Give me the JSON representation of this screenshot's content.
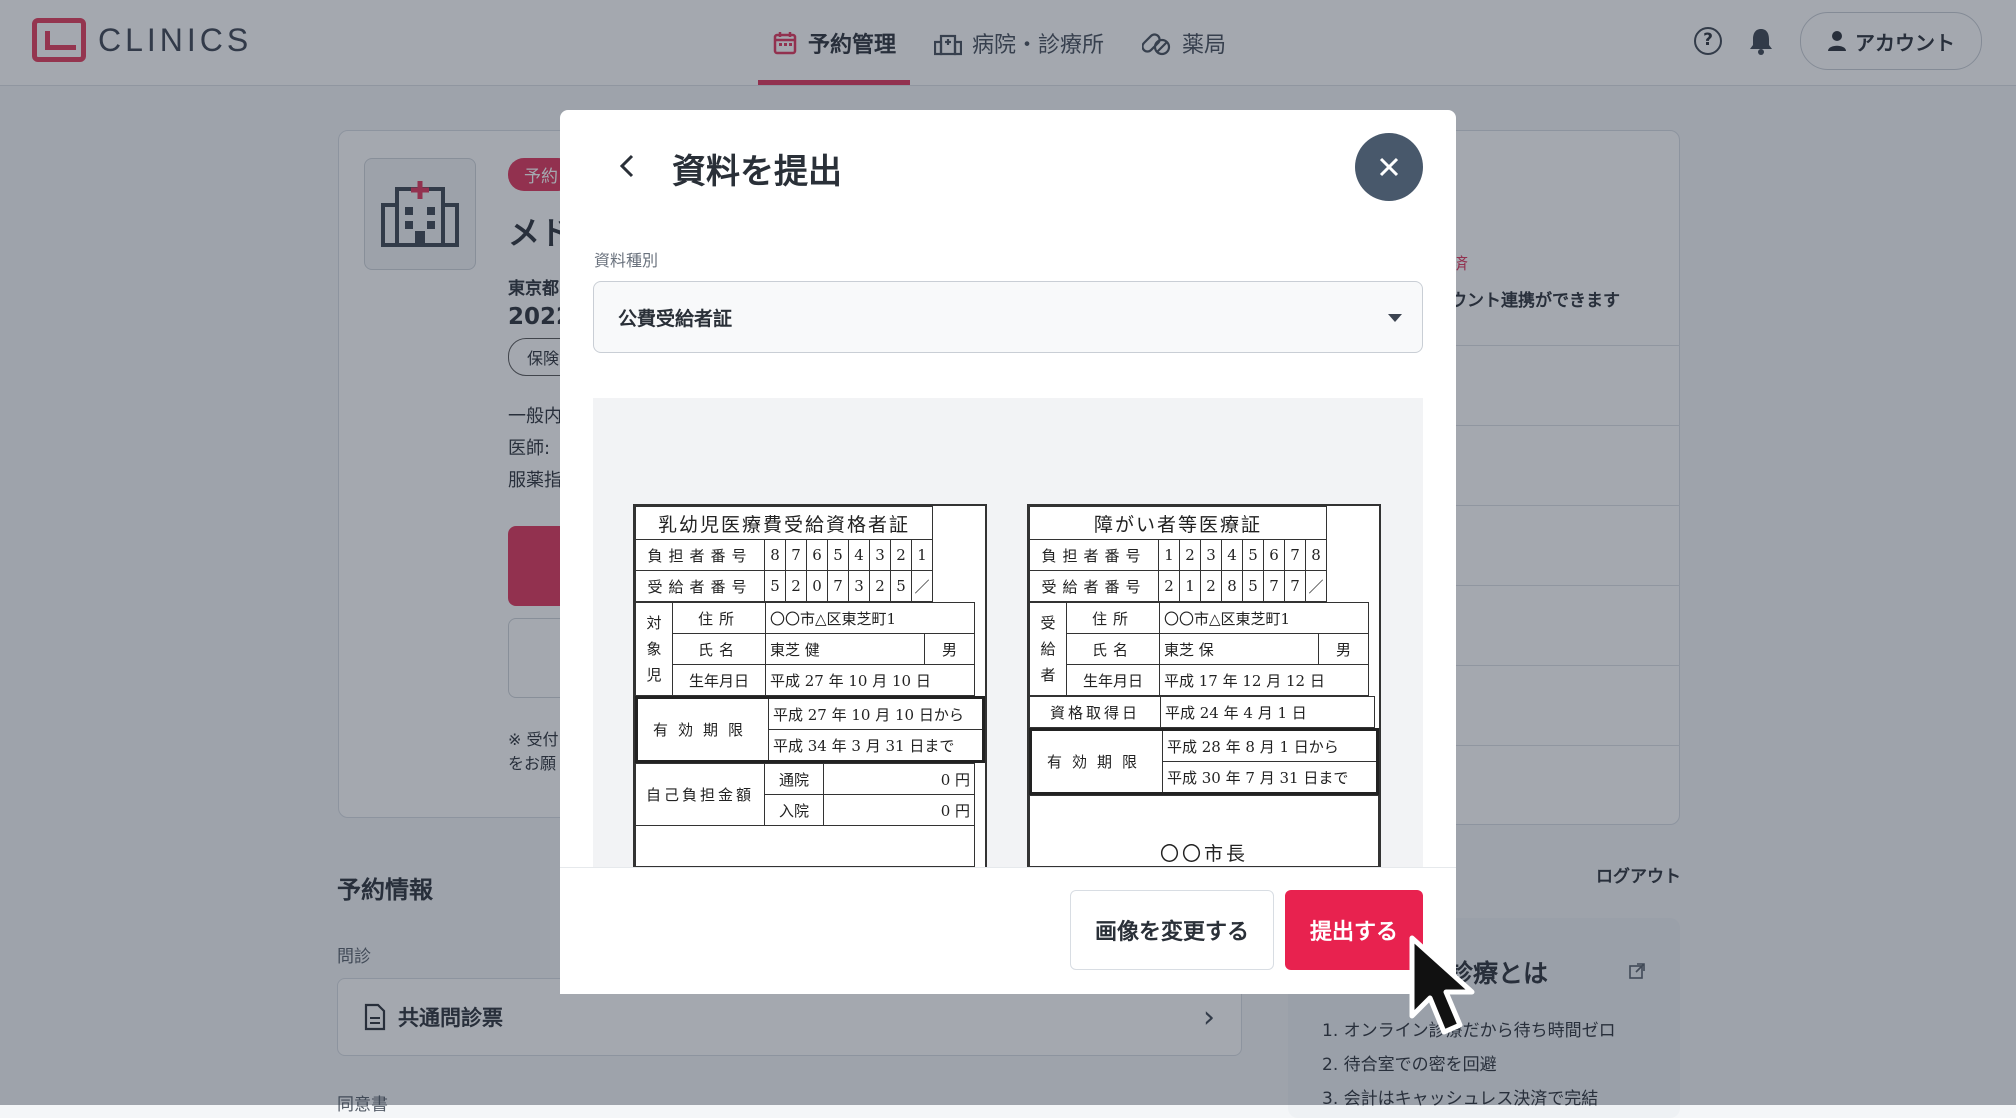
{
  "header": {
    "logo_text": "CLINICS",
    "nav": [
      {
        "label": "予約管理",
        "active": true
      },
      {
        "label": "病院・診療所",
        "active": false
      },
      {
        "label": "薬局",
        "active": false
      }
    ],
    "help_symbol": "?",
    "account_label": "アカウント"
  },
  "background": {
    "badge": "予約",
    "title": "メド",
    "address": "東京都",
    "date": "2022",
    "tag": "保険",
    "lines": [
      "一般内",
      "医師:",
      "服薬指"
    ],
    "note": [
      "※ 受付",
      "をお願"
    ],
    "side_status": "済",
    "side_text": "ウント連携ができます",
    "section_title": "予約情報",
    "monshin_label": "問診",
    "monshin_item": "共通問診票",
    "doui_label": "同意書",
    "logout": "ログアウト",
    "online_title": "診療とは",
    "online_list": [
      "1. オンライン診療だから待ち時間ゼロ",
      "2. 待合室での密を回避",
      "3. 会計はキャッシュレス決済で完結"
    ]
  },
  "modal": {
    "title": "資料を提出",
    "field_label": "資料種別",
    "selected_type": "公費受給者証",
    "change_button": "画像を変更する",
    "submit_button": "提出する"
  },
  "certificates": {
    "left": {
      "title": "乳幼児医療費受給資格者証",
      "burden_label": "負担者番号",
      "burden_digits": [
        "8",
        "7",
        "6",
        "5",
        "4",
        "3",
        "2",
        "1"
      ],
      "recipient_label": "受給者番号",
      "recipient_digits": [
        "5",
        "2",
        "0",
        "7",
        "3",
        "2",
        "5"
      ],
      "subject_label": "対象児",
      "address_label": "住所",
      "address": "〇〇市△区東芝町1",
      "name_label": "氏名",
      "name": "東芝 健",
      "sex": "男",
      "birth_label": "生年月日",
      "birth": "平成 27 年 10 月 10 日",
      "valid_label": "有効期限",
      "valid_from": "平成 27 年 10 月 10 日から",
      "valid_to": "平成 34 年 3 月 31 日まで",
      "copay_label": "自己負担金額",
      "outpatient_label": "通院",
      "outpatient": "0 円",
      "inpatient_label": "入院",
      "inpatient": "0 円"
    },
    "right": {
      "title": "障がい者等医療証",
      "burden_label": "負担者番号",
      "burden_digits": [
        "1",
        "2",
        "3",
        "4",
        "5",
        "6",
        "7",
        "8"
      ],
      "recipient_label": "受給者番号",
      "recipient_digits": [
        "2",
        "1",
        "2",
        "8",
        "5",
        "7",
        "7"
      ],
      "subject_label": "受給者",
      "address_label": "住所",
      "address": "〇〇市△区東芝町1",
      "name_label": "氏名",
      "name": "東芝 保",
      "sex": "男",
      "birth_label": "生年月日",
      "birth": "平成 17 年 12 月 12 日",
      "acquired_label": "資格取得日",
      "acquired": "平成 24 年 4 月 1 日",
      "valid_label": "有効期限",
      "valid_from": "平成 28 年 8 月 1 日から",
      "valid_to": "平成 30 年 7 月 31 日まで",
      "issuer": "〇〇市長"
    }
  },
  "colors": {
    "accent": "#e8224f",
    "close_button": "#48586b",
    "overlay": "rgba(38,48,64,0.42)"
  }
}
